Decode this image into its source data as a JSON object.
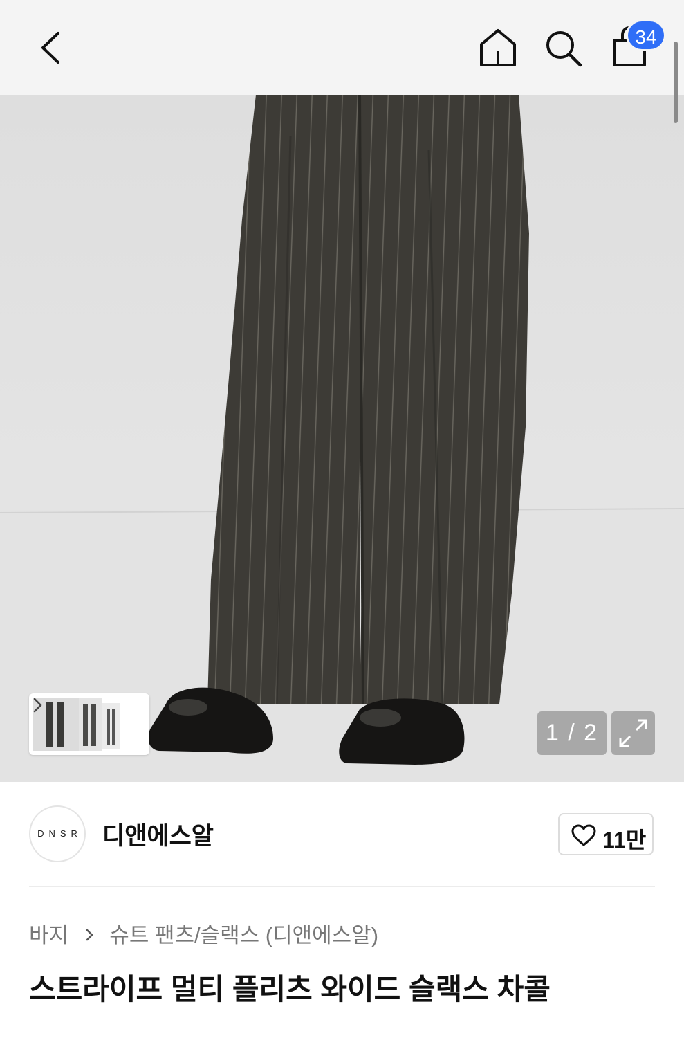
{
  "header": {
    "back_icon": "chevron-left-icon",
    "home_icon": "home-icon",
    "search_icon": "search-icon",
    "bag_icon": "shopping-bag-icon",
    "cart_count": "34",
    "badge_color": "#2f6ef7"
  },
  "gallery": {
    "pager_text": "1 / 2",
    "expand_icon": "expand-icon",
    "thumbnail_next_icon": "chevron-right-icon"
  },
  "brand": {
    "logo_text": "DNSR",
    "name": "디앤에스알",
    "like_icon": "heart-icon",
    "like_count": "11만"
  },
  "product": {
    "breadcrumb": [
      "바지",
      "슈트 팬츠/슬랙스 (디앤에스알)"
    ],
    "breadcrumb_sep_icon": "chevron-right-icon",
    "title": "스트라이프 멀티 플리츠 와이드 슬랙스 차콜"
  }
}
